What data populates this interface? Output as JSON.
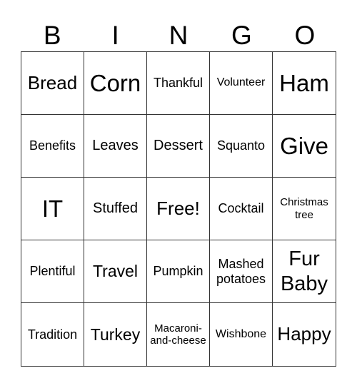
{
  "header": [
    "B",
    "I",
    "N",
    "G",
    "O"
  ],
  "cells": [
    {
      "text": "Bread",
      "size": "s-m"
    },
    {
      "text": "Corn",
      "size": "s-xl"
    },
    {
      "text": "Thankful",
      "size": "s-xs"
    },
    {
      "text": "Volunteer",
      "size": "s-xxs"
    },
    {
      "text": "Ham",
      "size": "s-xl"
    },
    {
      "text": "Benefits",
      "size": "s-xs"
    },
    {
      "text": "Leaves",
      "size": "s-s"
    },
    {
      "text": "Dessert",
      "size": "s-s"
    },
    {
      "text": "Squanto",
      "size": "s-xs"
    },
    {
      "text": "Give",
      "size": "s-xl"
    },
    {
      "text": "IT",
      "size": "s-xl"
    },
    {
      "text": "Stuffed",
      "size": "s-s"
    },
    {
      "text": "Free!",
      "size": "s-m"
    },
    {
      "text": "Cocktail",
      "size": "s-xs"
    },
    {
      "text": "Christmas tree",
      "size": "s-t"
    },
    {
      "text": "Plentiful",
      "size": "s-xs"
    },
    {
      "text": "Travel",
      "size": "s-ml"
    },
    {
      "text": "Pumpkin",
      "size": "s-xs"
    },
    {
      "text": "Mashed potatoes",
      "size": "s-xs"
    },
    {
      "text": "Fur Baby",
      "size": "s-l"
    },
    {
      "text": "Tradition",
      "size": "s-xs"
    },
    {
      "text": "Turkey",
      "size": "s-ml"
    },
    {
      "text": "Macaroni-and-cheese",
      "size": "s-t"
    },
    {
      "text": "Wishbone",
      "size": "s-xxs"
    },
    {
      "text": "Happy",
      "size": "s-m"
    }
  ]
}
